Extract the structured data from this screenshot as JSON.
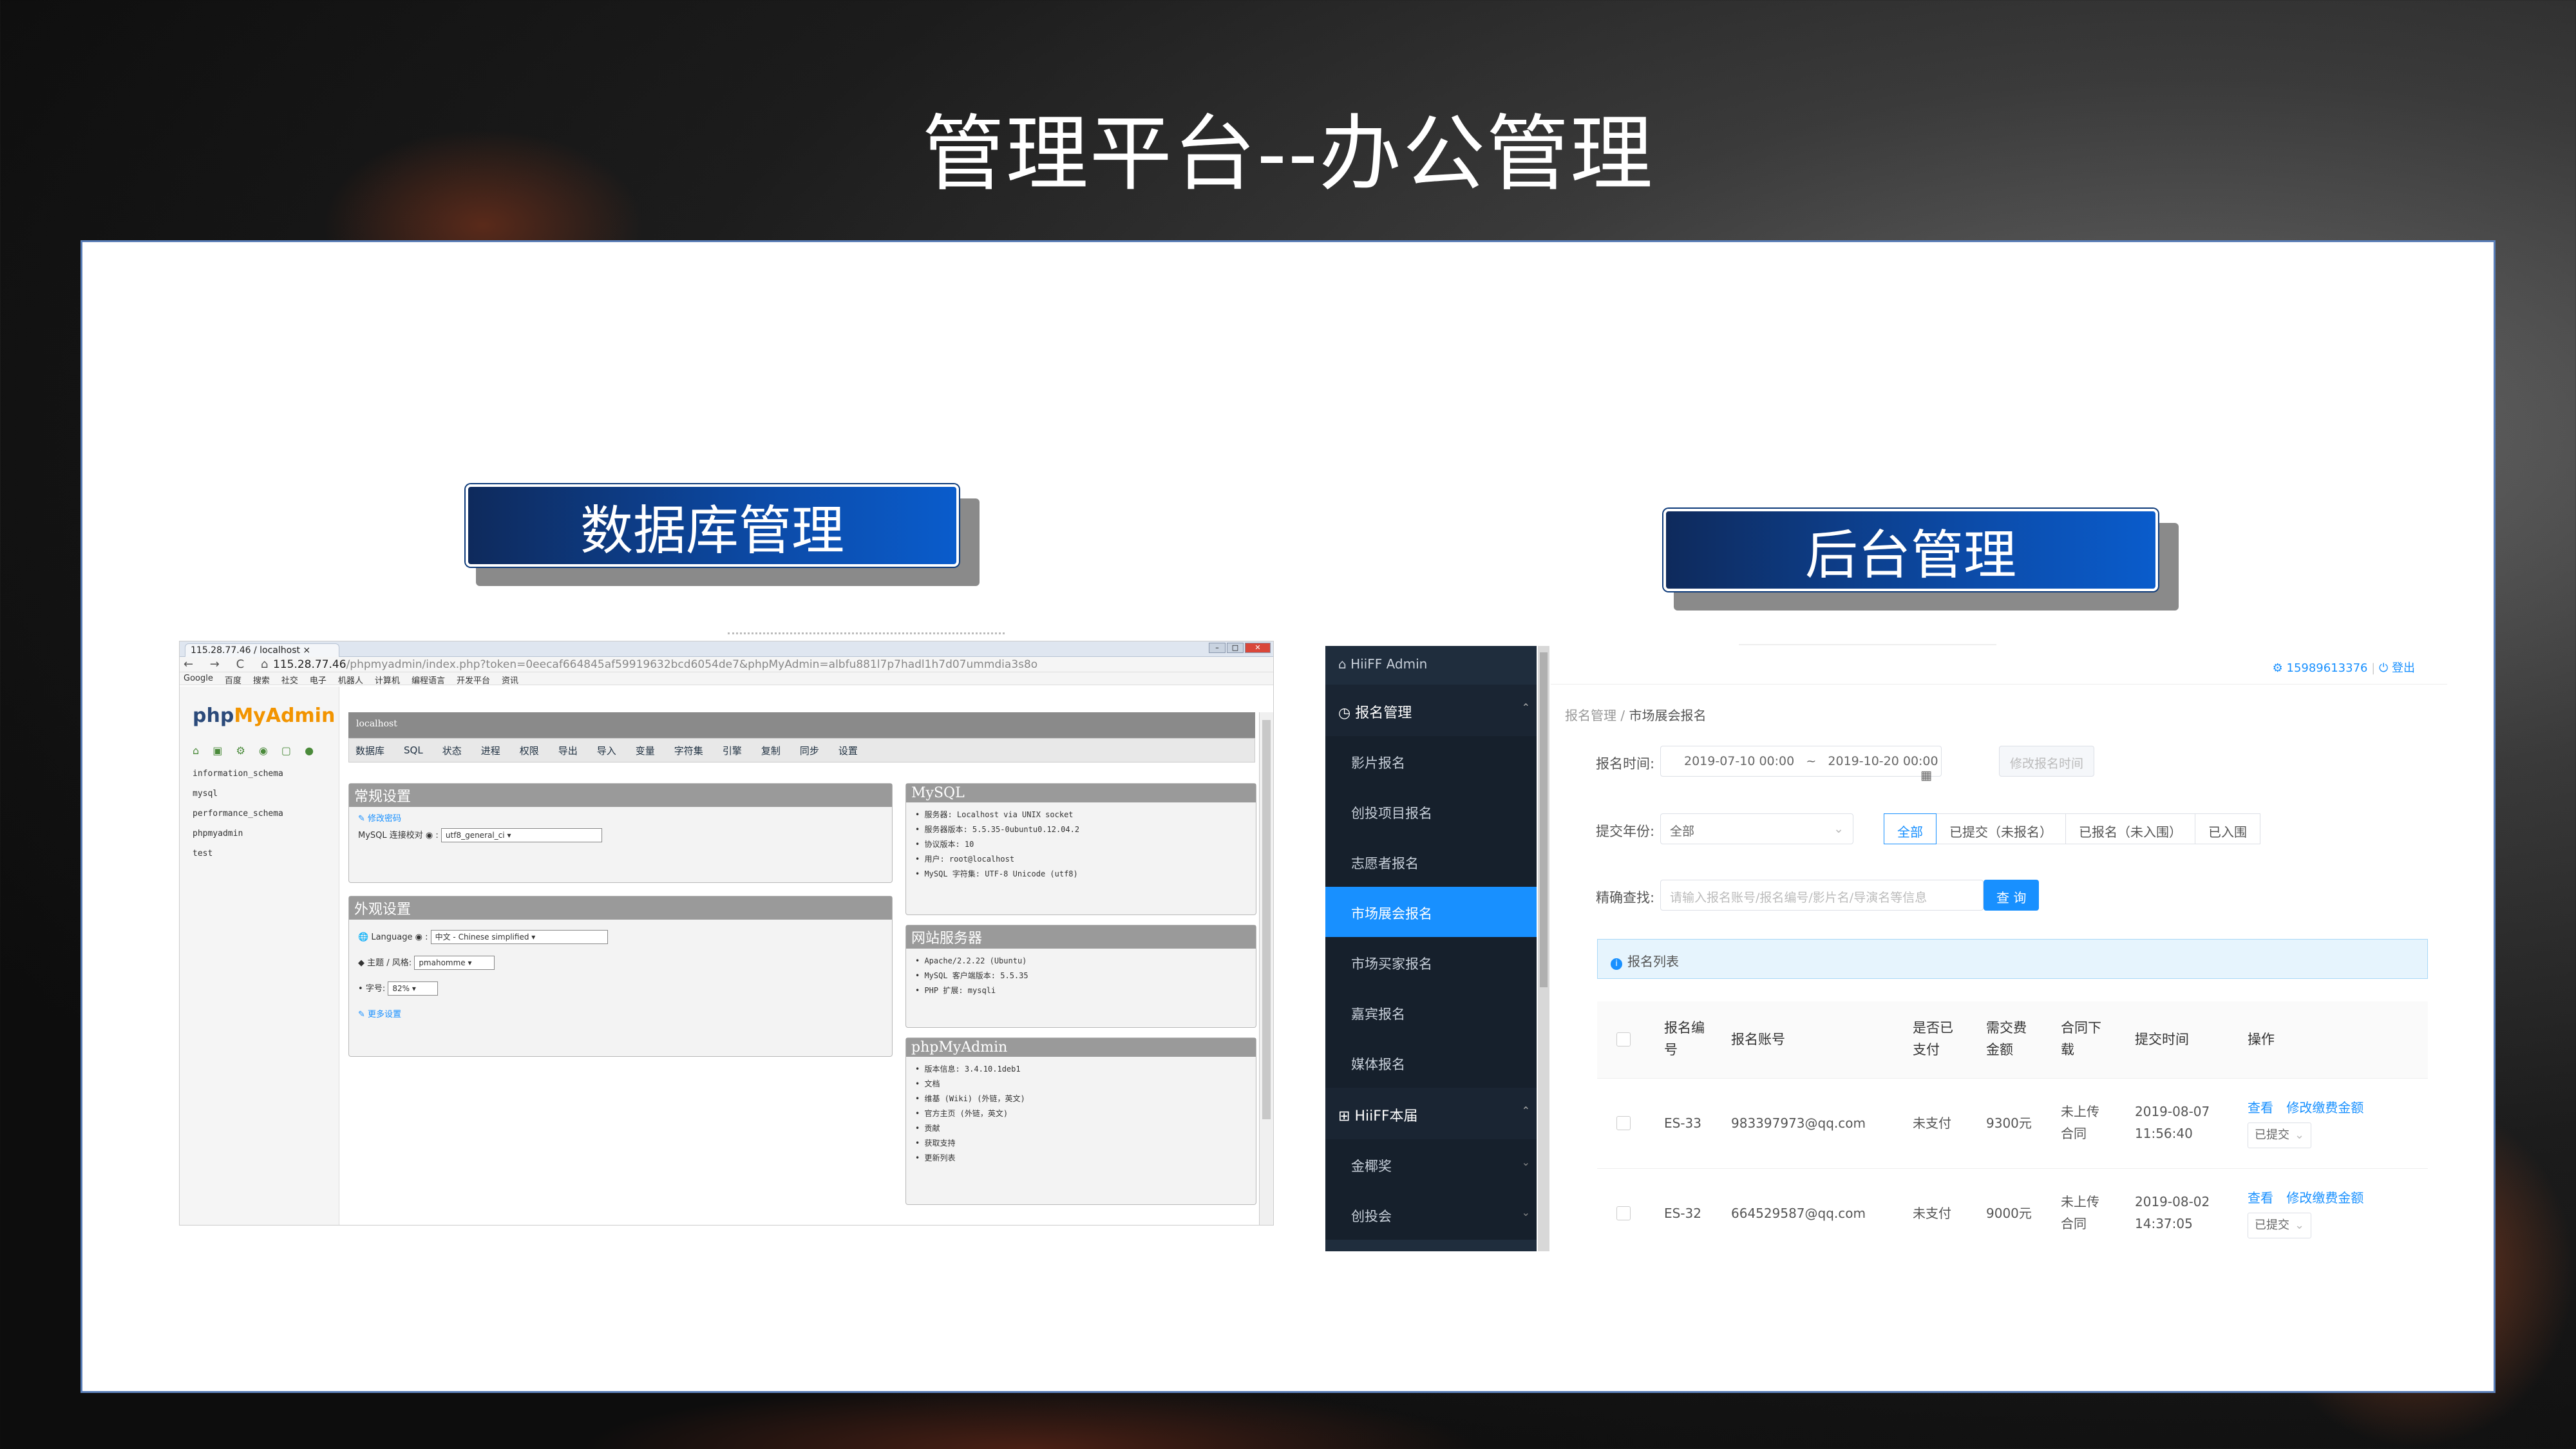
{
  "slide": {
    "title": "管理平台--办公管理",
    "label_left": "数据库管理",
    "label_right": "后台管理"
  },
  "pma": {
    "tab_title": "115.28.77.46 / localhost",
    "nav_glyphs": "← → C ⌂",
    "url_host": "115.28.77.46",
    "url_path": "/phpmyadmin/index.php?token=0eecaf664845af59919632bcd6054de7&phpMyAdmin=albfu881l7p7hadl1h7d07ummdia3s8o",
    "bookmarks": [
      "Google",
      "百度",
      "搜索",
      "社交",
      "电子",
      "机器人",
      "计算机",
      "编程语言",
      "开发平台",
      "资讯"
    ],
    "logo_php": "php",
    "logo_myadmin": "MyAdmin",
    "databases": [
      "information_schema",
      "mysql",
      "performance_schema",
      "phpmyadmin",
      "test"
    ],
    "breadcrumb": "localhost",
    "tabs": [
      "数据库",
      "SQL",
      "状态",
      "进程",
      "权限",
      "导出",
      "导入",
      "变量",
      "字符集",
      "引擎",
      "复制",
      "同步",
      "设置"
    ],
    "general": {
      "title": "常规设置",
      "change_password": "修改密码",
      "collation_label": "MySQL 连接校对",
      "collation_value": "utf8_general_ci"
    },
    "appearance": {
      "title": "外观设置",
      "language_label": "Language",
      "language_value": "中文 - Chinese simplified",
      "theme_label": "主题 / 风格:",
      "theme_value": "pmahomme",
      "font_label": "字号:",
      "font_value": "82%",
      "more": "更多设置"
    },
    "mysql": {
      "title": "MySQL",
      "lines": [
        "服务器: Localhost via UNIX socket",
        "服务器版本: 5.5.35-0ubuntu0.12.04.2",
        "协议版本: 10",
        "用户: root@localhost",
        "MySQL 字符集: UTF-8 Unicode (utf8)"
      ]
    },
    "webserver": {
      "title": "网站服务器",
      "lines": [
        "Apache/2.2.22 (Ubuntu)",
        "MySQL 客户端版本: 5.5.35",
        "PHP 扩展: mysqli"
      ]
    },
    "pmainfo": {
      "title": "phpMyAdmin",
      "lines": [
        "版本信息: 3.4.10.1deb1",
        "文档",
        "维基 (Wiki) (外链，英文)",
        "官方主页 (外链，英文)",
        "贡献",
        "获取支持",
        "更新列表"
      ]
    }
  },
  "admin": {
    "brand": "HiiFF Admin",
    "group1": "报名管理",
    "items1": [
      "影片报名",
      "创投项目报名",
      "志愿者报名",
      "市场展会报名",
      "市场买家报名",
      "嘉宾报名",
      "媒体报名"
    ],
    "group2": "HiiFF本届",
    "items2": [
      "金椰奖",
      "创投会"
    ],
    "user": "15989613376",
    "logout": "登出",
    "crumb_root": "报名管理",
    "crumb_current": "市场展会报名",
    "filter_time_label": "报名时间:",
    "date_start": "2019-07-10 00:00",
    "date_sep": "~",
    "date_end": "2019-10-20 00:00",
    "edit_time_btn": "修改报名时间",
    "year_label": "提交年份:",
    "year_value": "全部",
    "seg": [
      "全部",
      "已提交（未报名）",
      "已报名（未入围）",
      "已入围"
    ],
    "search_label": "精确查找:",
    "search_placeholder": "请输入报名账号/报名编号/影片名/导演名等信息",
    "query_btn": "查 询",
    "list_title": "报名列表",
    "headers": {
      "no": "报名编号",
      "account": "报名账号",
      "paid": "是否已支付",
      "fee": "需交费金额",
      "contract": "合同下载",
      "time": "提交时间",
      "op": "操作"
    },
    "rows": [
      {
        "no": "ES-33",
        "account": "983397973@qq.com",
        "paid": "未支付",
        "fee": "9300元",
        "contract": "未上传合同",
        "date": "2019-08-07",
        "clock": "11:56:40",
        "view": "查看",
        "edit": "修改缴费金额",
        "status": "已提交"
      },
      {
        "no": "ES-32",
        "account": "664529587@qq.com",
        "paid": "未支付",
        "fee": "9000元",
        "contract": "未上传合同",
        "date": "2019-08-02",
        "clock": "14:37:05",
        "view": "查看",
        "edit": "修改缴费金额",
        "status": "已提交"
      }
    ]
  }
}
